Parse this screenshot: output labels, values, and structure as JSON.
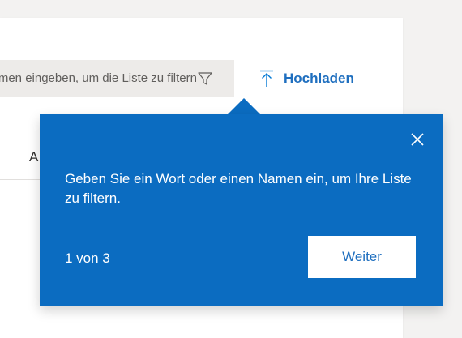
{
  "toolbar": {
    "filter_placeholder": "Namen eingeben, um die Liste zu filtern",
    "upload_label": "Hochladen"
  },
  "list": {
    "first_column_header": "A"
  },
  "teaching_callout": {
    "message": "Geben Sie ein Wort oder einen Namen ein, um Ihre Liste zu filtern.",
    "step_counter": "1 von 3",
    "next_label": "Weiter"
  },
  "icons": {
    "filter": "filter-icon",
    "upload": "upload-arrow-icon",
    "close": "close-icon"
  },
  "colors": {
    "accent": "#0078d4",
    "callout_background": "#0b6cc1",
    "page_background": "#f3f2f1",
    "search_background": "#edebe9"
  }
}
